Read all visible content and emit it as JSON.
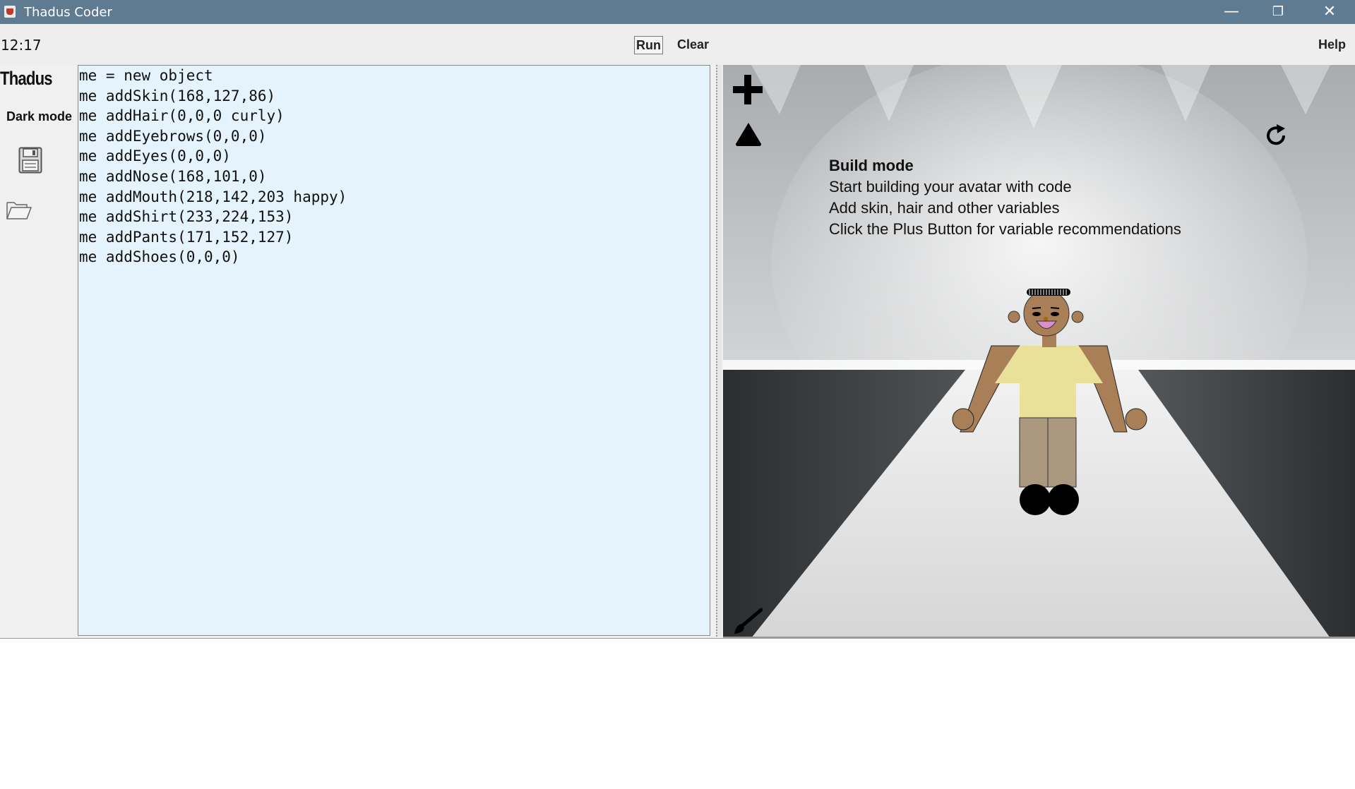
{
  "window": {
    "title": "Thadus Coder",
    "controls": {
      "minimize": "—",
      "maximize": "❐",
      "close": "✕"
    }
  },
  "toolbar": {
    "clock": "12:17",
    "run_label": "Run",
    "clear_label": "Clear",
    "help_label": "Help"
  },
  "sidebar": {
    "brand": "Thadus",
    "dark_mode_label": "Dark mode",
    "icons": [
      "save-icon",
      "open-folder-icon"
    ]
  },
  "editor": {
    "lines": [
      "me = new object",
      "me addSkin(168,127,86)",
      "me addHair(0,0,0 curly)",
      "me addEyebrows(0,0,0)",
      "me addEyes(0,0,0)",
      "me addNose(168,101,0)",
      "me addMouth(218,142,203 happy)",
      "me addShirt(233,224,153)",
      "me addPants(171,152,127)",
      "me addShoes(0,0,0)"
    ]
  },
  "stage": {
    "title": "Build mode",
    "lines": [
      "Start building your avatar with code",
      "Add skin, hair and other variables",
      "Click the Plus Button for variable recommendations"
    ],
    "icons": [
      "plus-icon",
      "triangle-icon",
      "refresh-icon",
      "paintbrush-icon"
    ],
    "avatar": {
      "skin": "#a87f56",
      "hair": "#000000",
      "eyebrows": "#000000",
      "eyes": "#000000",
      "nose": "#a86500",
      "mouth": "#da8ecb",
      "shirt": "#e9e099",
      "pants": "#ab987f",
      "shoes": "#000000"
    }
  },
  "console": {
    "text": ""
  }
}
